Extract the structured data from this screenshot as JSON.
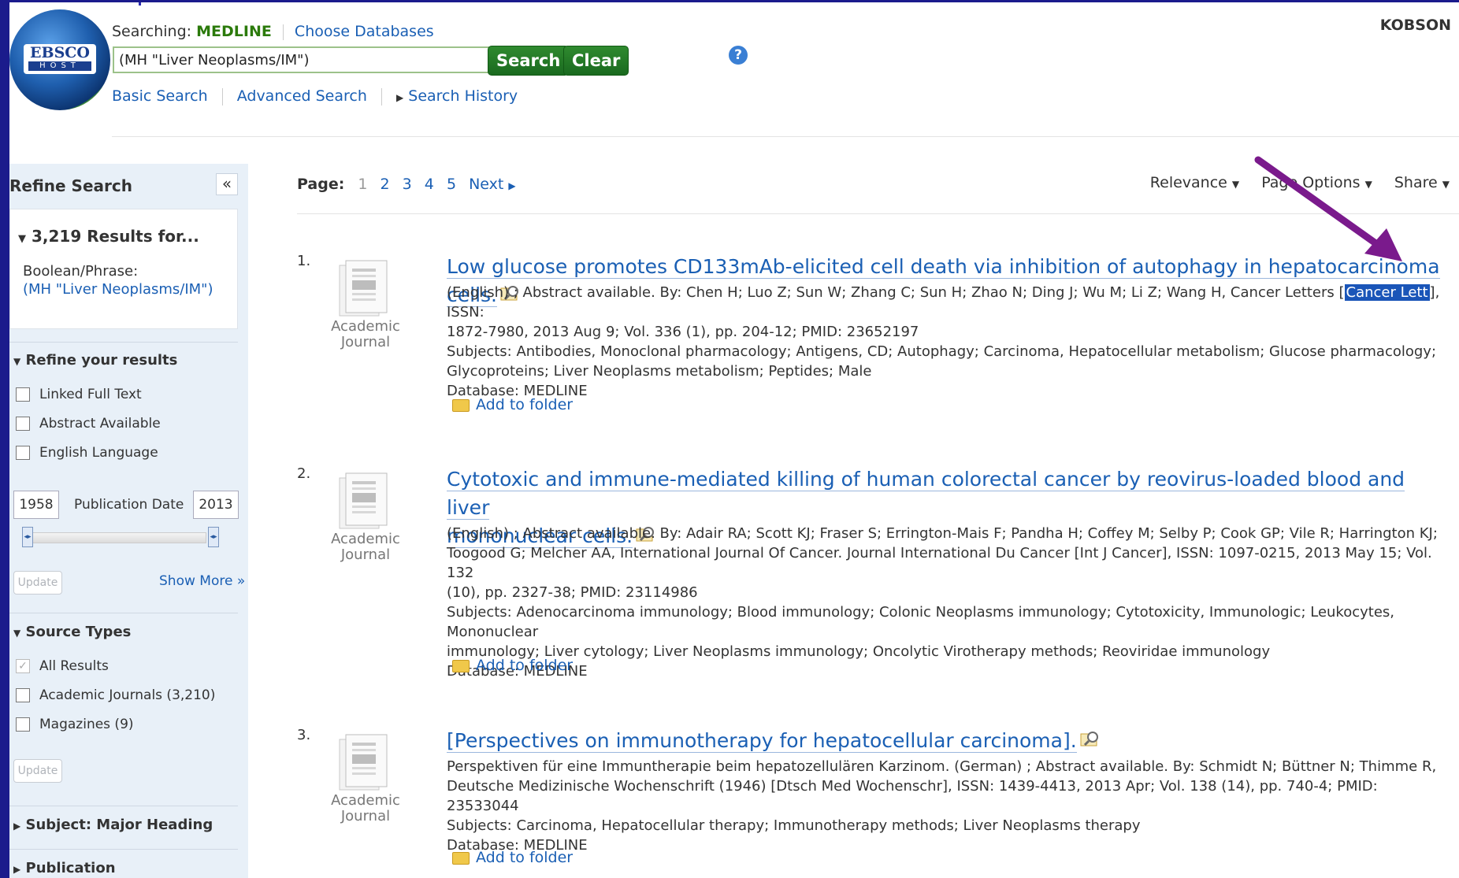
{
  "header": {
    "searching_label": "Searching:",
    "database": "MEDLINE",
    "choose_databases": "Choose Databases",
    "query": "(MH \"Liver Neoplasms/IM\")",
    "search_button": "Search",
    "clear_button": "Clear",
    "help_glyph": "?",
    "institution": "KOBSON",
    "nav": {
      "basic": "Basic Search",
      "advanced": "Advanced Search",
      "history": "Search History"
    },
    "logo_line1": "EBSCO",
    "logo_line2": "HOST"
  },
  "sidebar": {
    "title": "Refine Search",
    "collapse_glyph": "«",
    "results_count": "3,219 Results for...",
    "boolean_label": "Boolean/Phrase:",
    "boolean_query": "(MH \"Liver Neoplasms/IM\")",
    "refine_title": "Refine your results",
    "refine_options": [
      "Linked Full Text",
      "Abstract Available",
      "English Language"
    ],
    "date_from": "1958",
    "date_to": "2013",
    "date_label": "Publication Date",
    "update_label": "Update",
    "show_more": "Show More »",
    "source_types_title": "Source Types",
    "source_types": [
      "All Results",
      "Academic Journals (3,210)",
      "Magazines (9)"
    ],
    "subject_title": "Subject: Major Heading",
    "publication_title": "Publication"
  },
  "pager": {
    "label": "Page:",
    "pages": [
      "1",
      "2",
      "3",
      "4",
      "5"
    ],
    "current": "1",
    "next": "Next"
  },
  "toolbar": {
    "relevance": "Relevance",
    "page_options": "Page Options",
    "share": "Share"
  },
  "doc_type_label_1": "Academic",
  "doc_type_label_2": "Journal",
  "add_to_folder": "Add to folder",
  "results": [
    {
      "num": "1.",
      "title_line1": "Low glucose promotes CD133mAb-elicited cell death via inhibition of autophagy in hepatocarcinoma cells.",
      "cit_line1_a": "(English) ; Abstract available. By: Chen H; Luo Z; Sun W; Zhang C; Sun H; Zhao N; Ding J; Wu M; Li Z; Wang H, Cancer Letters [",
      "cit_highlight": "Cancer Lett",
      "cit_line1_b": "], ISSN:",
      "cit_line2": "1872-7980, 2013 Aug 9; Vol. 336 (1), pp. 204-12; PMID: 23652197",
      "subj_line1": "Subjects: Antibodies, Monoclonal pharmacology; Antigens, CD; Autophagy; Carcinoma, Hepatocellular metabolism; Glucose pharmacology;",
      "subj_line2": "Glycoproteins; Liver Neoplasms metabolism; Peptides; Male",
      "database": "Database: MEDLINE"
    },
    {
      "num": "2.",
      "title_line1": "Cytotoxic and immune-mediated killing of human colorectal cancer by reovirus-loaded blood and liver",
      "title_line2": "mononuclear cells.",
      "cit_line1": "(English) ; Abstract available. By: Adair RA; Scott KJ; Fraser S; Errington-Mais F; Pandha H; Coffey M; Selby P; Cook GP; Vile R; Harrington KJ;",
      "cit_line2": "Toogood G; Melcher AA, International Journal Of Cancer. Journal International Du Cancer [Int J Cancer], ISSN: 1097-0215, 2013 May 15; Vol. 132",
      "cit_line3": "(10), pp. 2327-38; PMID: 23114986",
      "subj_line1": "Subjects: Adenocarcinoma immunology; Blood immunology; Colonic Neoplasms immunology; Cytotoxicity, Immunologic; Leukocytes, Mononuclear",
      "subj_line2": "immunology; Liver cytology; Liver Neoplasms immunology; Oncolytic Virotherapy methods; Reoviridae immunology",
      "database": "Database: MEDLINE"
    },
    {
      "num": "3.",
      "title_line1": "[Perspectives on immunotherapy for hepatocellular carcinoma].",
      "cit_line1": "Perspektiven für eine Immuntherapie beim hepatozellulären Karzinom. (German) ; Abstract available. By: Schmidt N; Büttner N; Thimme R,",
      "cit_line2": "Deutsche Medizinische Wochenschrift (1946) [Dtsch Med Wochenschr], ISSN: 1439-4413, 2013 Apr; Vol. 138 (14), pp. 740-4; PMID: 23533044",
      "subj_line1": "Subjects: Carcinoma, Hepatocellular therapy; Immunotherapy methods; Liver Neoplasms therapy",
      "database": "Database: MEDLINE"
    }
  ],
  "colors": {
    "frame": "#1b1b8c",
    "link": "#1a5fb4",
    "green_button": "#1a6a1f",
    "highlight": "#1a55b8",
    "arrow": "#7a1a8c"
  }
}
